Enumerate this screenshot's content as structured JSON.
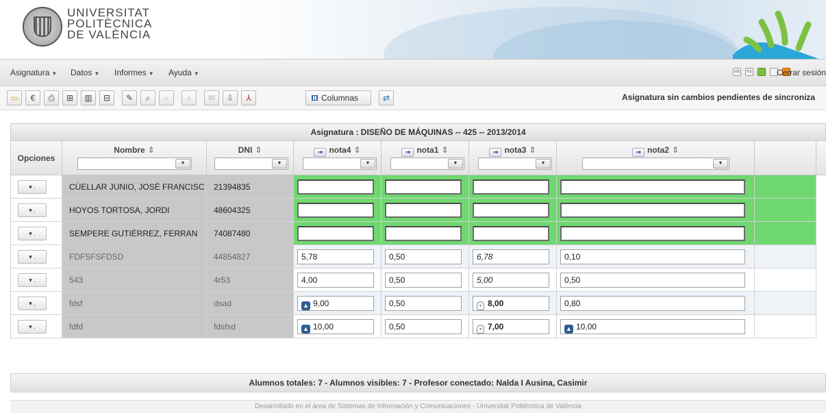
{
  "brand": {
    "line1": "UNIVERSITAT",
    "line2": "POLITÈCNICA",
    "line3": "DE VALÈNCIA"
  },
  "menu": [
    {
      "label": "Asignatura"
    },
    {
      "label": "Datos"
    },
    {
      "label": "Informes"
    },
    {
      "label": "Ayuda"
    }
  ],
  "top_right": {
    "logout_label": "Cerrar sesión",
    "icons": [
      "va-lang-icon",
      "es-lang-icon",
      "en-lang-icon",
      "options-icon",
      "lock-icon"
    ]
  },
  "toolbar": {
    "columns_label": "Columnas",
    "status_text": "Asignatura sin cambios pendientes de sincroniza"
  },
  "grid": {
    "caption": "Asignatura : DISEÑO DE MÁQUINAS -- 425 -- 2013/2014",
    "headers": {
      "opciones": "Opciones",
      "nombre": "Nombre",
      "dni": "DNI",
      "nota4": "nota4",
      "nota1": "nota1",
      "nota3": "nota3",
      "nota2": "nota2"
    },
    "sort_glyph": "⇕",
    "option_glyph": "▾ .",
    "rows": [
      {
        "nombre": "CÚELLAR JUNIO, JOSÉ FRANCISC",
        "dni": "21394835",
        "nota4": "",
        "nota1": "",
        "nota3": "",
        "nota2": "",
        "pending": true
      },
      {
        "nombre": "HOYOS TORTOSA, JORDI",
        "dni": "48604325",
        "nota4": "",
        "nota1": "",
        "nota3": "",
        "nota2": "",
        "pending": true
      },
      {
        "nombre": "SEMPERE GUTIÉRREZ, FERRAN",
        "dni": "74087480",
        "nota4": "",
        "nota1": "",
        "nota3": "",
        "nota2": "",
        "pending": true
      },
      {
        "nombre": "FDFSFSFDSD",
        "dni": "44854827",
        "nota4": "5,78",
        "nota1": "0,50",
        "nota3": "6,78",
        "nota2": "0,10",
        "pending": false
      },
      {
        "nombre": "543",
        "dni": "4r53",
        "nota4": "4,00",
        "nota1": "0,50",
        "nota3": "5,00",
        "nota2": "0,50",
        "pending": false
      },
      {
        "nombre": "fdsf",
        "dni": "dsad",
        "nota4": "9,00",
        "nota1": "0,50",
        "nota3": "8,00",
        "nota2": "0,80",
        "pending": false
      },
      {
        "nombre": "fdfd",
        "dni": "fdsfsd",
        "nota4": "10,00",
        "nota1": "0,50",
        "nota3": "7,00",
        "nota2": "10,00",
        "pending": false
      }
    ]
  },
  "footer": {
    "summary": "Alumnos totales: 7 - Alumnos visibles: 7 - Profesor conectado: Nalda I Ausina, Casimir",
    "credit": "Desarrollado en el área de Sistemas de Información y Comunicaciones - Universitat Politècnica de València"
  },
  "colors": {
    "pending_row": "#6fd86f",
    "name_cell_bg": "#c8c8c8",
    "alt_row": "#eef3f8"
  }
}
